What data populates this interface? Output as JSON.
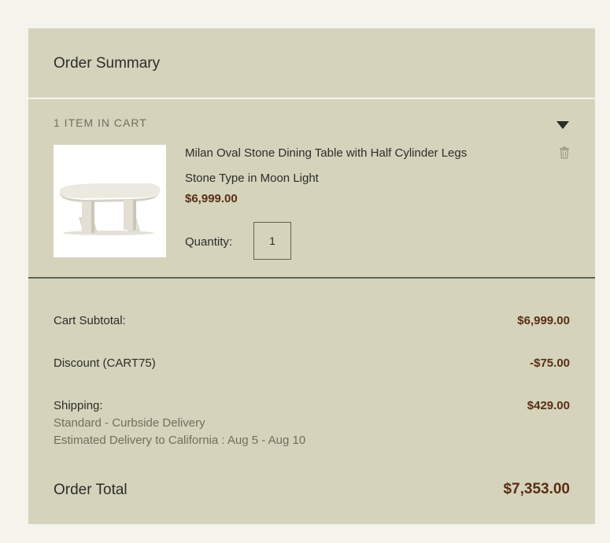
{
  "order_summary": {
    "title": "Order Summary"
  },
  "cart": {
    "items_count_label": "1 ITEM IN CART",
    "toggle_icon": "caret-down-icon",
    "delete_icon": "trash-icon",
    "item": {
      "name": "Milan Oval Stone Dining Table with Half Cylinder Legs",
      "variant": "Stone Type in Moon Light",
      "price": "$6,999.00",
      "quantity_label": "Quantity:",
      "quantity": "1"
    }
  },
  "totals": {
    "subtotal_label": "Cart Subtotal:",
    "subtotal_value": "$6,999.00",
    "discount_label": "Discount (CART75)",
    "discount_value": "-$75.00",
    "shipping_label": "Shipping:",
    "shipping_value": "$429.00",
    "shipping_method": "Standard - Curbside Delivery",
    "shipping_estimate": "Estimated Delivery to California : Aug 5 - Aug 10",
    "order_total_label": "Order Total",
    "order_total_value": "$7,353.00"
  },
  "colors": {
    "panel_background": "#d5d3bb",
    "page_background": "#f4f3ec",
    "price_color": "#5a2e16",
    "divider_dark": "#5d6356"
  }
}
